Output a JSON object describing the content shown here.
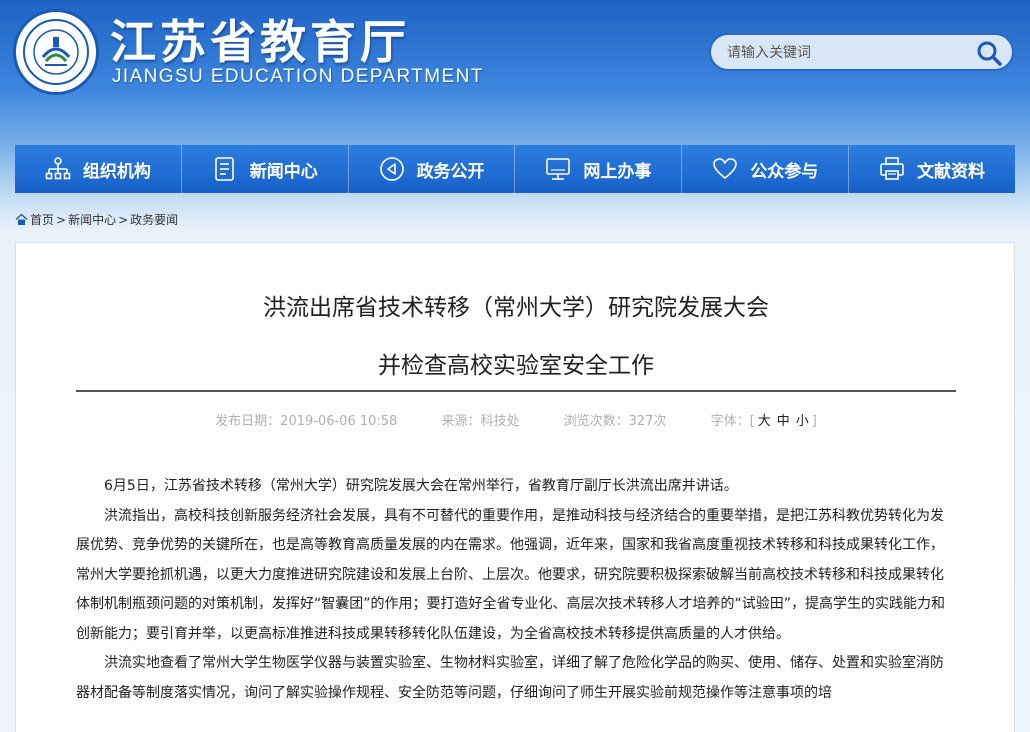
{
  "header": {
    "title": "江苏省教育厅",
    "subtitle": "JIANGSU EDUCATION DEPARTMENT",
    "search_placeholder": "请输入关键词"
  },
  "nav": [
    {
      "label": "组织机构",
      "icon": "org-chart-icon"
    },
    {
      "label": "新闻中心",
      "icon": "document-icon"
    },
    {
      "label": "政务公开",
      "icon": "speaker-icon"
    },
    {
      "label": "网上办事",
      "icon": "monitor-icon"
    },
    {
      "label": "公众参与",
      "icon": "heart-icon"
    },
    {
      "label": "文献资料",
      "icon": "printer-icon"
    }
  ],
  "breadcrumb": {
    "home": "首页",
    "sep": ">",
    "news": "新闻中心",
    "current": "政务要闻"
  },
  "article": {
    "title_line1": "洪流出席省技术转移（常州大学）研究院发展大会",
    "title_line2": "并检查高校实验室安全工作",
    "date": "发布日期：2019-06-06 10:58",
    "source": "来源：科技处",
    "views": "浏览次数：327次",
    "font_label": "字体：",
    "font_open": "[",
    "font_large": "大",
    "font_medium": "中",
    "font_small": "小",
    "font_close": "]",
    "paragraphs": [
      "6月5日，江苏省技术转移（常州大学）研究院发展大会在常州举行，省教育厅副厅长洪流出席并讲话。",
      "洪流指出，高校科技创新服务经济社会发展，具有不可替代的重要作用，是推动科技与经济结合的重要举措，是把江苏科教优势转化为发展优势、竞争优势的关键所在，也是高等教育高质量发展的内在需求。他强调，近年来，国家和我省高度重视技术转移和科技成果转化工作，常州大学要抢抓机遇，以更大力度推进研究院建设和发展上台阶、上层次。他要求，研究院要积极探索破解当前高校技术转移和科技成果转化体制机制瓶颈问题的对策机制，发挥好“智囊团”的作用；要打造好全省专业化、高层次技术转移人才培养的“试验田”，提高学生的实践能力和创新能力；要引育并举，以更高标准推进科技成果转移转化队伍建设，为全省高校技术转移提供高质量的人才供给。",
      "洪流实地查看了常州大学生物医学仪器与装置实验室、生物材料实验室，详细了解了危险化学品的购买、使用、储存、处置和实验室消防器材配备等制度落实情况，询问了解实验操作规程、安全防范等问题，仔细询问了师生开展实验前规范操作等注意事项的培"
    ]
  },
  "colors": {
    "nav_bg": "#1761c9",
    "header_bg": "#1e63c6",
    "content_bg": "#ffffff"
  }
}
